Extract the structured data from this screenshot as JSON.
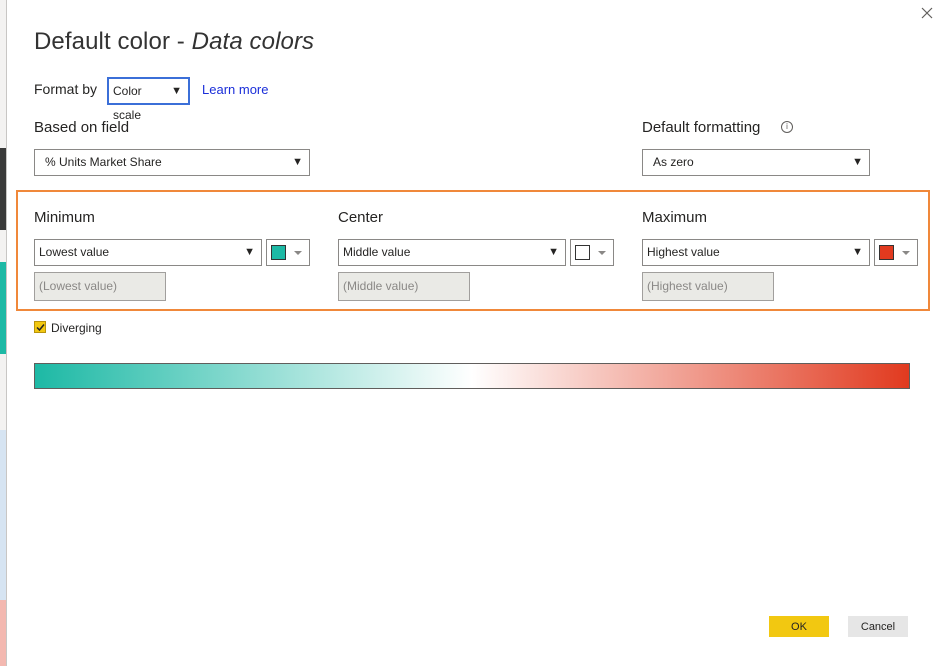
{
  "dialog": {
    "title_main": "Default color - ",
    "title_italic": "Data colors"
  },
  "format_by": {
    "label": "Format by",
    "value": "Color scale",
    "learn_more": "Learn more"
  },
  "based_on_field": {
    "label": "Based on field",
    "value": "% Units Market Share"
  },
  "default_formatting": {
    "label": "Default formatting",
    "value": "As zero",
    "info_icon": "info-icon"
  },
  "minimum": {
    "label": "Minimum",
    "value": "Lowest value",
    "color": "#1db9a5",
    "placeholder": "(Lowest value)"
  },
  "center": {
    "label": "Center",
    "value": "Middle value",
    "color": "#ffffff",
    "placeholder": "(Middle value)"
  },
  "maximum": {
    "label": "Maximum",
    "value": "Highest value",
    "color": "#e13a1f",
    "placeholder": "(Highest value)"
  },
  "diverging": {
    "label": "Diverging",
    "checked": true
  },
  "gradient": {
    "start": "#1db9a5",
    "middle": "#ffffff",
    "end": "#e13a1f"
  },
  "buttons": {
    "ok": "OK",
    "cancel": "Cancel"
  }
}
